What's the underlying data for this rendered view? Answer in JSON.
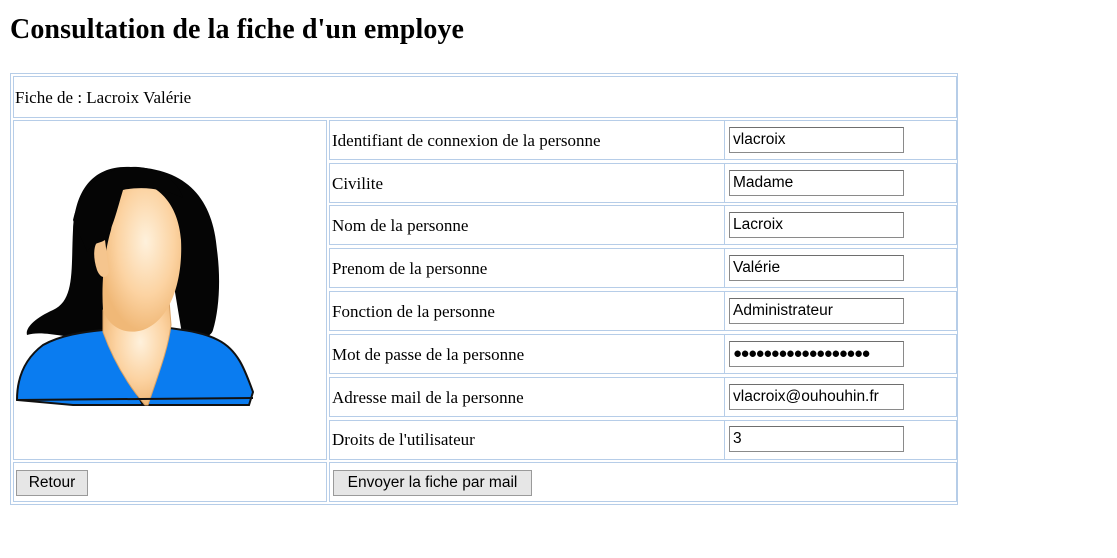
{
  "page": {
    "title": "Consultation de la fiche d'un employe"
  },
  "card": {
    "header": "Fiche de : Lacroix Valérie",
    "avatar_icon": "female-user-avatar-icon",
    "fields": [
      {
        "label": "Identifiant de connexion de la personne",
        "value": "vlacroix"
      },
      {
        "label": "Civilite",
        "value": "Madame"
      },
      {
        "label": "Nom de la personne",
        "value": "Lacroix"
      },
      {
        "label": "Prenom de la personne",
        "value": "Valérie"
      },
      {
        "label": "Fonction de la personne",
        "value": "Administrateur"
      },
      {
        "label": "Mot de passe de la personne",
        "value": "●●●●●●●●●●●●●●●●●●"
      },
      {
        "label": "Adresse mail de la personne",
        "value": "vlacroix@ouhouhin.fr"
      },
      {
        "label": "Droits de l'utilisateur",
        "value": "3"
      }
    ]
  },
  "actions": {
    "back_label": "Retour",
    "send_label": "Envoyer la fiche par mail"
  },
  "colors": {
    "border": "#b6cde8",
    "jacket": "#0a7cf0",
    "hair": "#050505",
    "skin": "#fcd3a2"
  }
}
